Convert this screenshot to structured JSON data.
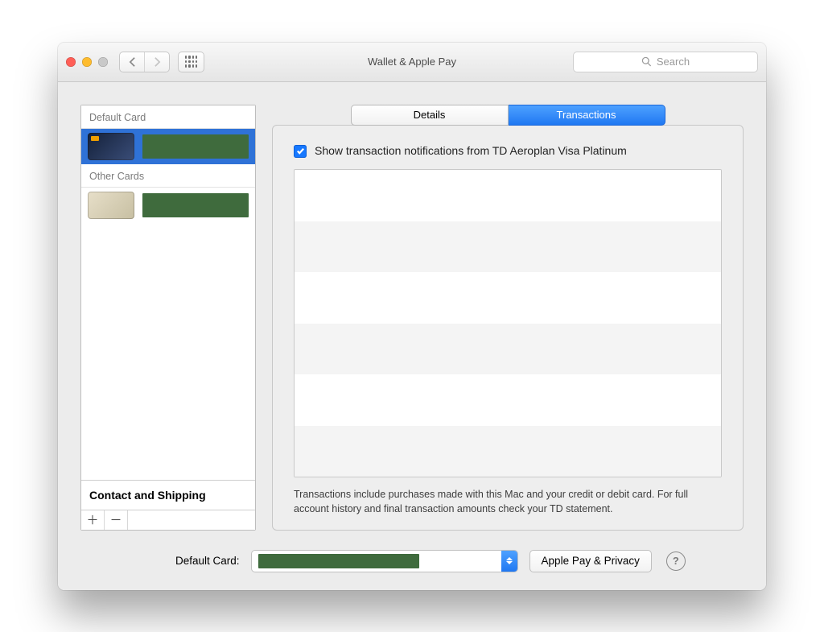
{
  "header": {
    "title": "Wallet & Apple Pay",
    "search_placeholder": "Search"
  },
  "sidebar": {
    "default_header": "Default Card",
    "other_header": "Other Cards",
    "contact_label": "Contact and Shipping",
    "cards": [
      {
        "section": "default",
        "name_redacted": true,
        "selected": true,
        "card_style": "visa"
      },
      {
        "section": "other",
        "name_redacted": true,
        "selected": false,
        "card_style": "other"
      }
    ]
  },
  "panel": {
    "tabs": [
      {
        "label": "Details",
        "active": false
      },
      {
        "label": "Transactions",
        "active": true
      }
    ],
    "notif_checked": true,
    "notif_label": "Show transaction notifications from TD Aeroplan Visa Platinum",
    "transactions": [],
    "footnote": "Transactions include purchases made with this Mac and your credit or debit card. For full account history and final transaction amounts check your TD statement."
  },
  "footer": {
    "default_card_label": "Default Card:",
    "default_card_value_redacted": true,
    "privacy_button": "Apple Pay & Privacy"
  },
  "colors": {
    "selection_blue": "#2f72d7",
    "accent_blue": "#1f78f2",
    "redaction_green": "#3f6b3d"
  }
}
